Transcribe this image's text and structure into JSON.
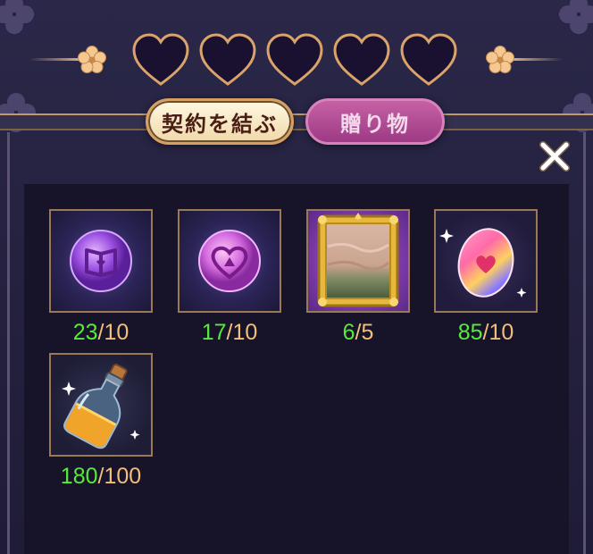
{
  "affection": {
    "hearts_total": 5,
    "hearts_filled": 0
  },
  "tabs": [
    {
      "label": "契約を結ぶ",
      "active": true
    },
    {
      "label": "贈り物",
      "active": false
    }
  ],
  "close_label": "close",
  "items": [
    {
      "name": "book-orb",
      "current": "23",
      "sep": "/",
      "required": "10"
    },
    {
      "name": "heart-orb",
      "current": "17",
      "sep": "/",
      "required": "10"
    },
    {
      "name": "painting",
      "current": "6",
      "sep": "/",
      "required": "5"
    },
    {
      "name": "rainbow-heart-egg",
      "current": "85",
      "sep": "/",
      "required": "10"
    },
    {
      "name": "potion-bottle",
      "current": "180",
      "sep": "/",
      "required": "100"
    }
  ],
  "colors": {
    "current_count": "#56ea3a",
    "required_count": "#f2be7a",
    "tab_active_bg": "#f6e6c2",
    "tab_inactive_bg": "#b24c94",
    "panel_bg": "#17142a"
  }
}
